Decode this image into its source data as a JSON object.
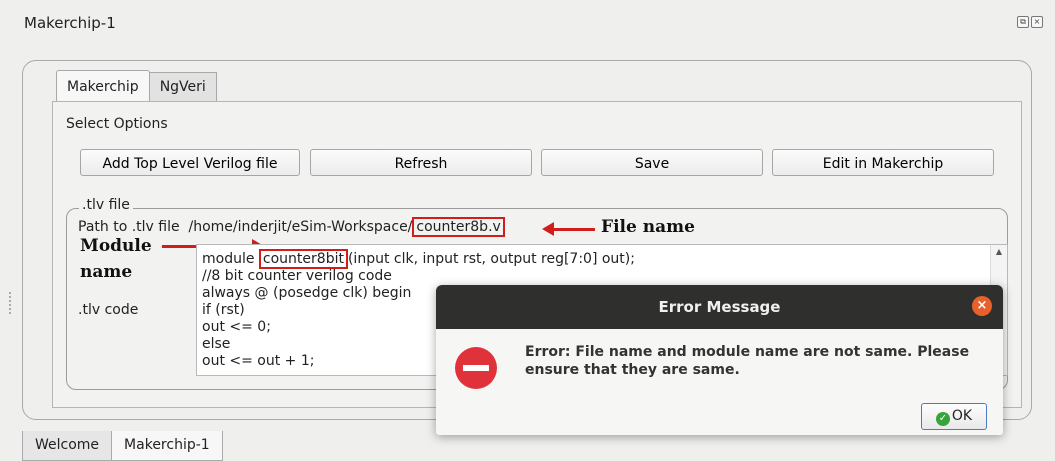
{
  "window": {
    "title": "Makerchip-1"
  },
  "tabs": [
    {
      "label": "Makerchip"
    },
    {
      "label": "NgVeri"
    }
  ],
  "select_options": {
    "label": "Select Options",
    "buttons": [
      {
        "label": "Add Top Level Verilog file"
      },
      {
        "label": "Refresh"
      },
      {
        "label": "Save"
      },
      {
        "label": "Edit in Makerchip"
      }
    ]
  },
  "tlv_group": {
    "title": ".tlv file",
    "path_label": "Path to .tlv file",
    "path_prefix": "/home/inderjit/eSim-Workspace/",
    "path_file": "counter8b.v",
    "code_label": ".tlv code",
    "code_lines": [
      {
        "pre": "module ",
        "hl": "counter8bit",
        "post": "(input clk, input rst, output reg[7:0] out);"
      },
      {
        "pre": "//8 bit counter verilog code",
        "hl": "",
        "post": ""
      },
      {
        "pre": "always @ (posedge clk) begin",
        "hl": "",
        "post": ""
      },
      {
        "pre": "if (rst)",
        "hl": "",
        "post": ""
      },
      {
        "pre": "out <= 0;",
        "hl": "",
        "post": ""
      },
      {
        "pre": "else",
        "hl": "",
        "post": ""
      },
      {
        "pre": "out <= out + 1;",
        "hl": "",
        "post": ""
      }
    ]
  },
  "annotations": {
    "file_name": "File name",
    "module_line1": "Module",
    "module_line2": "name",
    "color": "#d21d1d"
  },
  "dialog": {
    "title": "Error Message",
    "close_icon": "close-icon",
    "icon": "stop-icon",
    "message": "Error: File name and module name are not same. Please ensure that they are same.",
    "ok_label": "OK"
  },
  "bottom_tabs": [
    {
      "label": "Welcome"
    },
    {
      "label": "Makerchip-1"
    }
  ]
}
